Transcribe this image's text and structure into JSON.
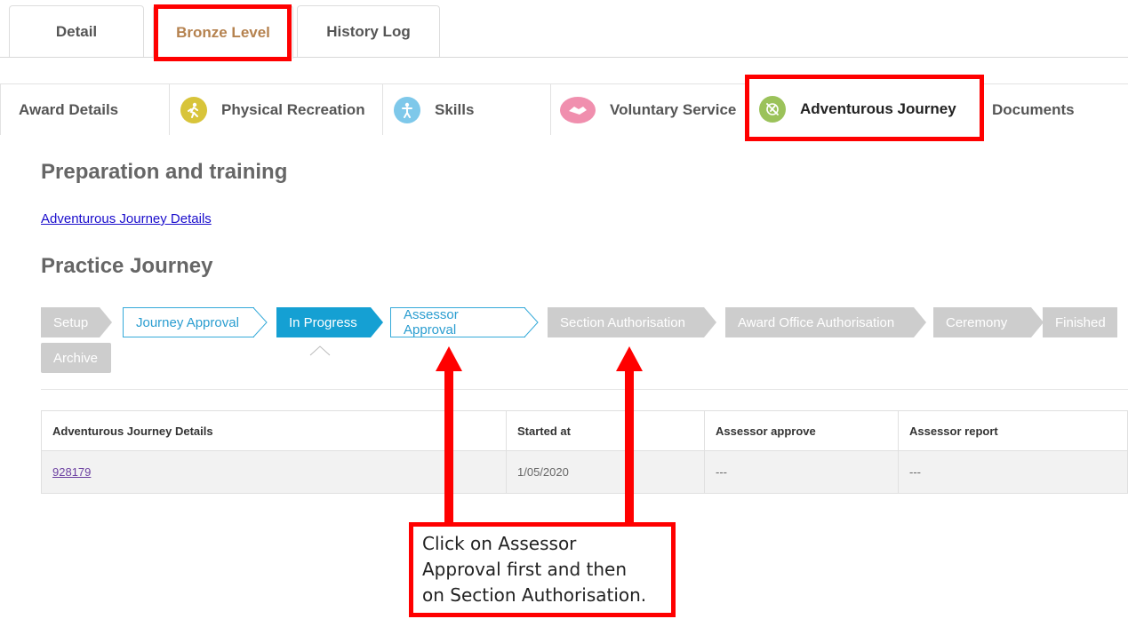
{
  "top_tabs": [
    {
      "label": "Detail"
    },
    {
      "label": "Bronze Level"
    },
    {
      "label": "History Log"
    }
  ],
  "section_tabs": [
    {
      "label": "Award Details"
    },
    {
      "label": "Physical Recreation",
      "icon": "running-person-icon",
      "color": "#d8c43a"
    },
    {
      "label": "Skills",
      "icon": "person-star-icon",
      "color": "#7ec8ea"
    },
    {
      "label": "Voluntary Service",
      "icon": "handshake-icon",
      "color": "#f08fae"
    },
    {
      "label": "Adventurous Journey",
      "icon": "compass-icon",
      "color": "#9bc25a"
    },
    {
      "label": "Documents"
    }
  ],
  "headings": {
    "prep": "Preparation and training",
    "prep_link": "Adventurous Journey Details",
    "practice": "Practice Journey"
  },
  "workflow_steps": [
    {
      "label": "Setup",
      "state": "done"
    },
    {
      "label": "Journey Approval",
      "state": "outline"
    },
    {
      "label": "In Progress",
      "state": "current"
    },
    {
      "label": "Assessor Approval",
      "state": "outline"
    },
    {
      "label": "Section Authorisation",
      "state": "pending"
    },
    {
      "label": "Award Office Authorisation",
      "state": "pending"
    },
    {
      "label": "Ceremony",
      "state": "pending"
    },
    {
      "label": "Finished",
      "state": "pending"
    },
    {
      "label": "Archive",
      "state": "pending"
    }
  ],
  "table": {
    "headers": [
      "Adventurous Journey Details",
      "Started at",
      "Assessor approve",
      "Assessor report"
    ],
    "rows": [
      [
        "928179",
        "1/05/2020",
        "---",
        "---"
      ]
    ]
  },
  "annotation": {
    "lines": [
      "Click on Assessor",
      "Approval first and then",
      "on Section Authorisation."
    ],
    "color": "#ff0000"
  },
  "colors": {
    "accent_blue": "#15a0d3",
    "bronze": "#b5824f"
  }
}
